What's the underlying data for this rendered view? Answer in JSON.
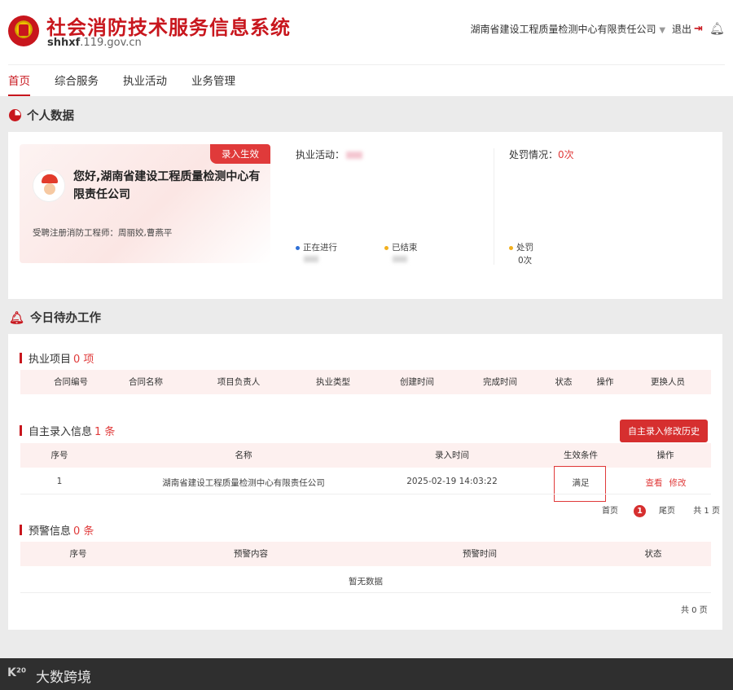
{
  "header": {
    "title": "社会消防技术服务信息系统",
    "domain_prefix": "shhxf",
    "domain_suffix": ".119.gov.cn",
    "org_name": "湖南省建设工程质量检测中心有限责任公司",
    "caret": "▼",
    "logout_label": "退出",
    "icons": {
      "emblem": "fire-service-emblem",
      "logout": "logout-icon",
      "bell": "bell-icon"
    }
  },
  "nav": {
    "items": [
      "首页",
      "综合服务",
      "执业活动",
      "业务管理"
    ],
    "active_index": 0
  },
  "personal": {
    "section_title": "个人数据",
    "tag": "录入生效",
    "greeting": "您好,湖南省建设工程质量检测中心有限责任公司",
    "engineers": "受聘注册消防工程师：周丽姣,曹燕平",
    "activity_label": "执业活动：",
    "penalty_label": "处罚情况：",
    "penalty_value": "0次",
    "legend": {
      "ongoing": "正在进行",
      "finished": "已结束",
      "penalty": "处罚",
      "penalty_count": "0次"
    },
    "colors": {
      "ongoing": "#2f6fd6",
      "finished": "#f2b01e",
      "penalty": "#f2b01e"
    }
  },
  "todo": {
    "section_title": "今日待办工作",
    "projects": {
      "title": "执业项目",
      "count": "0 项",
      "columns": [
        "合同编号",
        "合同名称",
        "项目负责人",
        "执业类型",
        "创建时间",
        "完成时间",
        "状态",
        "操作",
        "更换人员"
      ]
    },
    "self_entry": {
      "title": "自主录入信息",
      "count": "1 条",
      "history_button": "自主录入修改历史",
      "columns": [
        "序号",
        "名称",
        "录入时间",
        "生效条件",
        "操作"
      ],
      "rows": [
        {
          "index": "1",
          "name": "湖南省建设工程质量检测中心有限责任公司",
          "time": "2025-02-19 14:03:22",
          "condition": "满足",
          "view": "查看",
          "edit": "修改"
        }
      ],
      "pager": {
        "first": "首页",
        "current": "1",
        "last": "尾页",
        "total": "共 1 页"
      }
    },
    "warnings": {
      "title": "预警信息",
      "count": "0 条",
      "columns": [
        "序号",
        "预警内容",
        "预警时间",
        "状态"
      ],
      "empty": "暂无数据",
      "total": "共 0 页"
    }
  },
  "watermark": {
    "icon_text": "K²⁰",
    "text": "大数跨境"
  },
  "accent_color": "#c8161d"
}
